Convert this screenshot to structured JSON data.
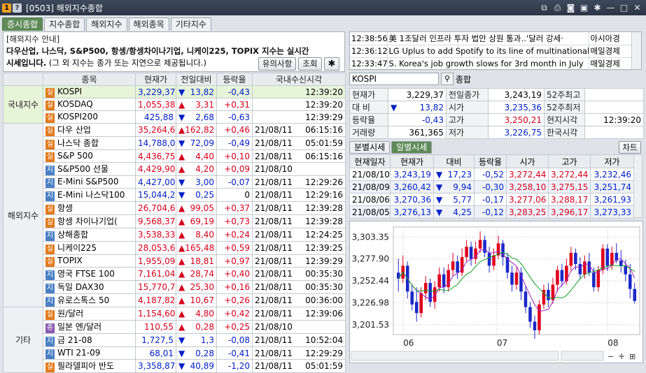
{
  "window": {
    "badge1": "1",
    "badge2": "?",
    "title": "[0503] 해외지수종합"
  },
  "tabs": [
    "증시종합",
    "지수종합",
    "해외지수",
    "해외종목",
    "기타지수"
  ],
  "notice": {
    "title": "[해외지수 안내]",
    "line1": "다우산업, 나스닥, S&P500, 항셍/항셍차이나기업, 니케이225, TOPIX 지수는 실시간",
    "line2_bold": "시세입니다.",
    "line2_rest": " (그 외 지수는 종가 또는 지연으로 제공됩니다.)",
    "btn_caution": "유의사항",
    "btn_query": "조회"
  },
  "table": {
    "headers": [
      "종목",
      "현재가",
      "전일대비",
      "등락율",
      "국내수신시각"
    ],
    "groups": [
      {
        "name": "국내지수",
        "rows": [
          {
            "badge": "실",
            "name": "KOSPI",
            "price": "3,229,37",
            "dir": "down",
            "chg": "13,82",
            "rate": "-0,43",
            "date": "",
            "time": "12:39:20"
          },
          {
            "badge": "실",
            "name": "KOSDAQ",
            "price": "1,055,38",
            "dir": "up",
            "chg": "3,31",
            "rate": "+0,31",
            "date": "",
            "time": "12:39:20"
          },
          {
            "badge": "실",
            "name": "KOSPI200",
            "price": "425,88",
            "dir": "down",
            "chg": "2,68",
            "rate": "-0,63",
            "date": "",
            "time": "12:39:29"
          }
        ]
      },
      {
        "name": "해외지수",
        "rows": [
          {
            "badge": "실",
            "name": "다우 산업",
            "price": "35,264,67",
            "dir": "up",
            "chg": "162,82",
            "rate": "+0,46",
            "date": "21/08/11",
            "time": "06:15:16"
          },
          {
            "badge": "실",
            "name": "나스닥 종합",
            "price": "14,788,09",
            "dir": "down",
            "chg": "72,09",
            "rate": "-0,49",
            "date": "21/08/11",
            "time": "05:01:59"
          },
          {
            "badge": "실",
            "name": "S&P 500",
            "price": "4,436,75",
            "dir": "up",
            "chg": "4,40",
            "rate": "+0,10",
            "date": "21/08/11",
            "time": "06:15:16"
          },
          {
            "badge": "지",
            "name": "S&P500 선물",
            "price": "4,429,90",
            "dir": "up",
            "chg": "4,20",
            "rate": "+0,09",
            "date": "21/08/10",
            "time": ""
          },
          {
            "badge": "지",
            "name": "E-Mini S&P500",
            "price": "4,427,00",
            "dir": "down",
            "chg": "3,00",
            "rate": "-0,07",
            "date": "21/08/11",
            "time": "12:29:26"
          },
          {
            "badge": "지",
            "name": "E-Mini 나스닥100",
            "price": "15,044,25",
            "dir": "down",
            "chg": "0,25",
            "rate": "0",
            "date": "21/08/11",
            "time": "12:29:16"
          },
          {
            "badge": "실",
            "name": "항셍",
            "price": "26,704,67",
            "dir": "up",
            "chg": "99,05",
            "rate": "+0,37",
            "date": "21/08/11",
            "time": "12:39:28"
          },
          {
            "badge": "실",
            "name": "항셍 차이나기업(",
            "price": "9,568,37",
            "dir": "up",
            "chg": "69,19",
            "rate": "+0,73",
            "date": "21/08/11",
            "time": "12:39:28"
          },
          {
            "badge": "지",
            "name": "상해종합",
            "price": "3,538,33",
            "dir": "up",
            "chg": "8,40",
            "rate": "+0,24",
            "date": "21/08/11",
            "time": "12:24:25"
          },
          {
            "badge": "실",
            "name": "니케이225",
            "price": "28,053,63",
            "dir": "up",
            "chg": "165,48",
            "rate": "+0,59",
            "date": "21/08/11",
            "time": "12:39:25"
          },
          {
            "badge": "실",
            "name": "TOPIX",
            "price": "1,955,09",
            "dir": "up",
            "chg": "18,81",
            "rate": "+0,97",
            "date": "21/08/11",
            "time": "12:39:29"
          },
          {
            "badge": "지",
            "name": "영국 FTSE 100",
            "price": "7,161,04",
            "dir": "up",
            "chg": "28,74",
            "rate": "+0,40",
            "date": "21/08/11",
            "time": "00:35:30"
          },
          {
            "badge": "지",
            "name": "독일 DAX30",
            "price": "15,770,71",
            "dir": "up",
            "chg": "25,30",
            "rate": "+0,16",
            "date": "21/08/11",
            "time": "00:35:30"
          },
          {
            "badge": "지",
            "name": "유로스톡스 50",
            "price": "4,187,82",
            "dir": "up",
            "chg": "10,67",
            "rate": "+0,26",
            "date": "21/08/11",
            "time": "00:36:00"
          }
        ]
      },
      {
        "name": "기타",
        "rows": [
          {
            "badge": "실",
            "name": "원/달러",
            "price": "1,154,60",
            "dir": "up",
            "chg": "4,80",
            "rate": "+0,42",
            "date": "21/08/11",
            "time": "12:39:06"
          },
          {
            "badge": "종",
            "name": "일본 엔/달러",
            "price": "110,55",
            "dir": "up",
            "chg": "0,28",
            "rate": "+0,25",
            "date": "21/08/10",
            "time": ""
          },
          {
            "badge": "지",
            "name": "금 21-08",
            "price": "1,727,5",
            "dir": "down",
            "chg": "1,3",
            "rate": "-0,08",
            "date": "21/08/11",
            "time": "10:52:04"
          },
          {
            "badge": "지",
            "name": "WTI 21-09",
            "price": "68,01",
            "dir": "down",
            "chg": "0,28",
            "rate": "-0,41",
            "date": "21/08/11",
            "time": "12:29:29"
          },
          {
            "badge": "실",
            "name": "필라델피아 반도",
            "price": "3,358,87",
            "dir": "down",
            "chg": "40,89",
            "rate": "-1,20",
            "date": "21/08/11",
            "time": "05:01:59"
          }
        ]
      }
    ]
  },
  "news": [
    {
      "time": "12:38:56",
      "title": "美 1조달러 인프라 투자 법안 상원 통과‥'달러 강세·",
      "source": "아시아경"
    },
    {
      "time": "12:36:12",
      "title": "LG Uplus to add Spotify to its line of multinational",
      "source": "매일경제"
    },
    {
      "time": "12:33:47",
      "title": "S. Korea's job growth slows for 3rd month in July",
      "source": "매일경제"
    }
  ],
  "symbol": {
    "code": "KOSPI",
    "name_label": "종합"
  },
  "quote": {
    "rows": [
      [
        "현재가",
        "3,229,37",
        "전일종가",
        "3,243,19",
        "52주최고",
        ""
      ],
      [
        "대 비",
        "13,82",
        "시가",
        "3,235,36",
        "52주최저",
        ""
      ],
      [
        "등락율",
        "-0,43",
        "고가",
        "3,250,21",
        "현지시각",
        "12:39:20"
      ],
      [
        "거래량",
        "361,365",
        "저가",
        "3,226,75",
        "한국시각",
        ""
      ]
    ]
  },
  "subtabs": [
    "분별시세",
    "일별시세"
  ],
  "chart_button": "차트",
  "daily": {
    "headers": [
      "현재일자",
      "현재가",
      "대비",
      "등락율",
      "시가",
      "고가",
      "저가"
    ],
    "rows": [
      {
        "date": "21/08/10",
        "price": "3,243,19",
        "dir": "down",
        "chg": "17,23",
        "rate": "-0,52",
        "open": "3,272,44",
        "high": "3,272,44",
        "low": "3,232,46"
      },
      {
        "date": "21/08/09",
        "price": "3,260,42",
        "dir": "down",
        "chg": "9,94",
        "rate": "-0,30",
        "open": "3,258,10",
        "high": "3,275,15",
        "low": "3,251,74"
      },
      {
        "date": "21/08/06",
        "price": "3,270,36",
        "dir": "down",
        "chg": "5,77",
        "rate": "-0,17",
        "open": "3,277,06",
        "high": "3,288,17",
        "low": "3,261,93"
      },
      {
        "date": "21/08/05",
        "price": "3,276,13",
        "dir": "down",
        "chg": "4,25",
        "rate": "-0,12",
        "open": "3,283,25",
        "high": "3,296,17",
        "low": "3,273,33"
      }
    ]
  },
  "chart_data": {
    "type": "candlestick",
    "yticks": [
      "3,303.35",
      "3,277.90",
      "3,252.44",
      "3,226.98",
      "3,201.53"
    ],
    "ylim": [
      3190,
      3315
    ],
    "xticks": [
      "06",
      "07",
      "08"
    ],
    "candles": [
      [
        3262,
        3255,
        3278,
        3240
      ],
      [
        3255,
        3270,
        3282,
        3250
      ],
      [
        3270,
        3240,
        3275,
        3232
      ],
      [
        3240,
        3225,
        3248,
        3218
      ],
      [
        3228,
        3215,
        3245,
        3205
      ],
      [
        3215,
        3238,
        3245,
        3210
      ],
      [
        3238,
        3250,
        3258,
        3230
      ],
      [
        3250,
        3228,
        3255,
        3222
      ],
      [
        3228,
        3245,
        3252,
        3220
      ],
      [
        3245,
        3260,
        3268,
        3240
      ],
      [
        3260,
        3245,
        3268,
        3238
      ],
      [
        3245,
        3265,
        3272,
        3240
      ],
      [
        3265,
        3275,
        3285,
        3258
      ],
      [
        3275,
        3262,
        3282,
        3255
      ],
      [
        3262,
        3280,
        3290,
        3258
      ],
      [
        3280,
        3292,
        3300,
        3275
      ],
      [
        3292,
        3278,
        3298,
        3270
      ],
      [
        3278,
        3290,
        3298,
        3272
      ],
      [
        3290,
        3300,
        3310,
        3285
      ],
      [
        3300,
        3285,
        3305,
        3280
      ],
      [
        3285,
        3270,
        3292,
        3262
      ],
      [
        3270,
        3282,
        3290,
        3265
      ],
      [
        3282,
        3296,
        3305,
        3278
      ],
      [
        3296,
        3280,
        3300,
        3270
      ],
      [
        3280,
        3262,
        3285,
        3255
      ],
      [
        3262,
        3248,
        3270,
        3240
      ],
      [
        3248,
        3262,
        3268,
        3242
      ],
      [
        3262,
        3240,
        3268,
        3230
      ],
      [
        3240,
        3222,
        3246,
        3215
      ],
      [
        3222,
        3205,
        3228,
        3198
      ],
      [
        3205,
        3195,
        3212,
        3185
      ],
      [
        3195,
        3225,
        3230,
        3190
      ],
      [
        3225,
        3242,
        3248,
        3220
      ],
      [
        3242,
        3230,
        3250,
        3222
      ],
      [
        3230,
        3248,
        3256,
        3226
      ],
      [
        3248,
        3265,
        3270,
        3240
      ],
      [
        3265,
        3252,
        3272,
        3246
      ],
      [
        3252,
        3270,
        3278,
        3248
      ],
      [
        3270,
        3285,
        3292,
        3265
      ],
      [
        3285,
        3272,
        3290,
        3265
      ],
      [
        3272,
        3260,
        3280,
        3254
      ],
      [
        3260,
        3275,
        3282,
        3255
      ],
      [
        3275,
        3262,
        3285,
        3258
      ],
      [
        3262,
        3245,
        3268,
        3240
      ],
      [
        3245,
        3265,
        3270,
        3240
      ],
      [
        3265,
        3290,
        3295,
        3260
      ],
      [
        3290,
        3270,
        3295,
        3264
      ],
      [
        3270,
        3285,
        3292,
        3265
      ],
      [
        3285,
        3276,
        3296,
        3273
      ],
      [
        3276,
        3270,
        3288,
        3262
      ],
      [
        3270,
        3260,
        3277,
        3252
      ],
      [
        3260,
        3243,
        3272,
        3232
      ],
      [
        3243,
        3229,
        3250,
        3226
      ]
    ]
  }
}
